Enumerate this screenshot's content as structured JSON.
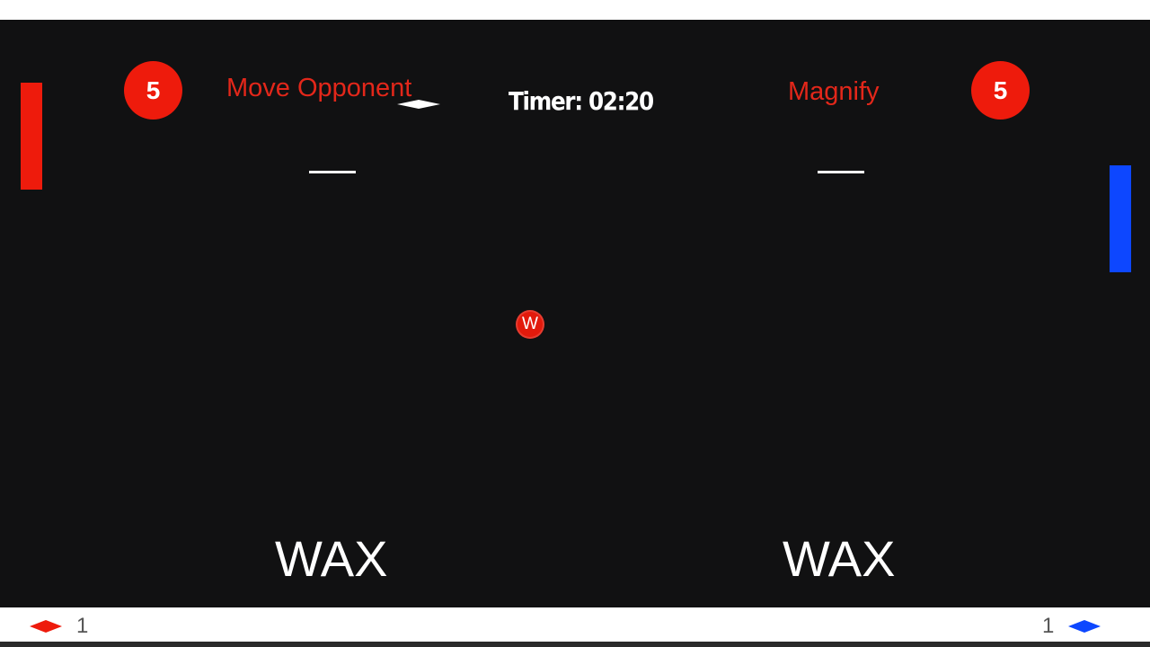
{
  "timer": {
    "text": "Timer: 02:20"
  },
  "players": {
    "left": {
      "color": "#ee1b0c",
      "powerup_count": "5",
      "powerup_label": "Move Opponent",
      "word": "WAX",
      "indicator_value": "1",
      "paddle_icon": "red-diamond-icon"
    },
    "right": {
      "color": "#0d47ff",
      "powerup_count": "5",
      "powerup_label": "Magnify",
      "word": "WAX",
      "indicator_value": "1",
      "paddle_icon": "blue-diamond-icon"
    }
  },
  "ball": {
    "letter": "W",
    "color": "#e21a0c"
  },
  "colors": {
    "background": "#111112",
    "score_circle": "#ee1b0c",
    "powerup_text": "#e3271a",
    "text": "#ffffff"
  }
}
